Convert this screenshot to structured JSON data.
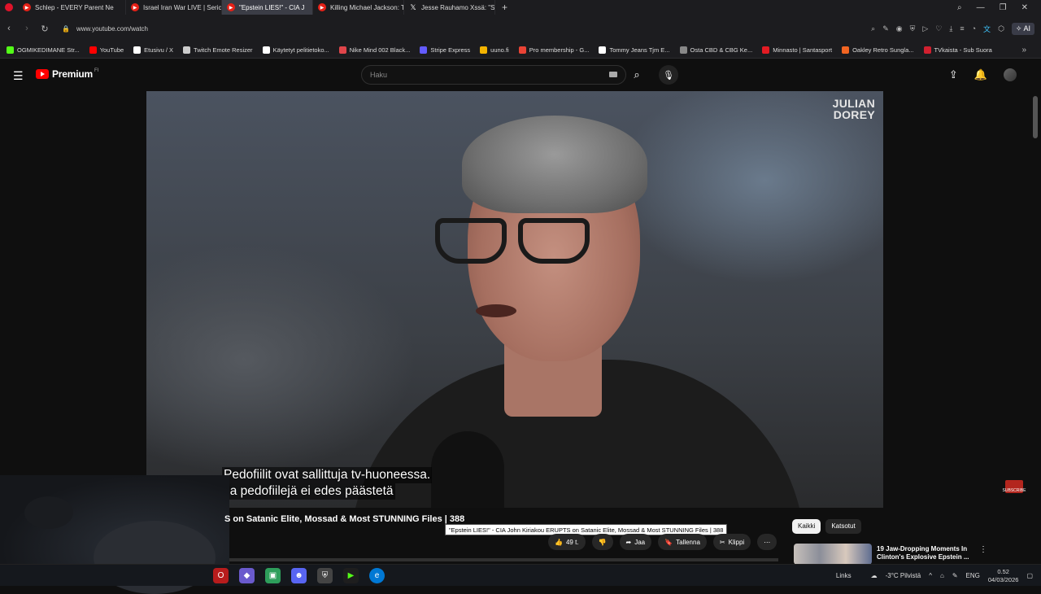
{
  "browser": {
    "tabs": [
      {
        "label": "Schlep - EVERY Parent Ne",
        "icon": "youtube-icon",
        "active": false
      },
      {
        "label": "Israel Iran War LIVE | Seric",
        "icon": "youtube-icon",
        "active": false
      },
      {
        "label": "\"Epstein LIES!\" - CIA J",
        "icon": "youtube-icon",
        "active": true
      },
      {
        "label": "Killing Michael Jackson: Th",
        "icon": "youtube-icon",
        "active": false
      },
      {
        "label": "Jesse Rauhamo Xssä: \"Suo",
        "icon": "x-icon",
        "active": false
      }
    ],
    "new_tab": "+",
    "url": "www.youtube.com/watch",
    "ai_label": "AI",
    "bookmarks": [
      {
        "label": "OGMIKEDIMANE Str...",
        "color": "#53fc18"
      },
      {
        "label": "YouTube",
        "color": "#ff0000"
      },
      {
        "label": "Etusivu / X",
        "color": "#ffffff"
      },
      {
        "label": "Twitch Emote Resizer",
        "color": "#cccccc"
      },
      {
        "label": "Käytetyt pelitietoko...",
        "color": "#ffffff"
      },
      {
        "label": "Nike Mind 002 Black...",
        "color": "#e0454a"
      },
      {
        "label": "Stripe Express",
        "color": "#635bff"
      },
      {
        "label": "uuno.fi",
        "color": "#f4b400"
      },
      {
        "label": "Pro membership - G...",
        "color": "#ea4335"
      },
      {
        "label": "Tommy Jeans Tjm E...",
        "color": "#ffffff"
      },
      {
        "label": "Osta CBD & CBG Ke...",
        "color": "#888888"
      },
      {
        "label": "Minnasto | Santasport",
        "color": "#e31b23"
      },
      {
        "label": "Oakley Retro Sungla...",
        "color": "#f26522"
      },
      {
        "label": "TVkaista - Sub Suora",
        "color": "#d1202f"
      }
    ]
  },
  "youtube": {
    "logo": "Premium",
    "logo_sup": "FI",
    "search_placeholder": "Haku",
    "watermark_line1": "JULIAN",
    "watermark_line2": "DOREY",
    "subtitle_line1": "Pedofiilit ovat sallittuja tv-huoneessa.",
    "subtitle_line2": "Ja pedofiilejä ei edes päästetä",
    "video_title": "S on Satanic Elite, Mossad & Most STUNNING Files | 388",
    "tooltip": "\"Epstein LIES!\" - CIA John Kiriakou ERUPTS on Satanic Elite, Mossad & Most STUNNING Files | 388",
    "likes": "49 t.",
    "share": "Jaa",
    "save": "Tallenna",
    "clip": "Klippi",
    "chips": [
      "Kaikki",
      "Katsotut"
    ],
    "recommendation_line1": "19 Jaw-Dropping Moments In",
    "recommendation_line2": "Clinton's Explosive Epstein ...",
    "subscribe_badge": "SUBSCRIBE"
  },
  "taskbar": {
    "links": "Links",
    "weather": "-3°C  Pilvistä",
    "lang": "ENG",
    "time": "0.52",
    "date": "04/03/2026"
  }
}
